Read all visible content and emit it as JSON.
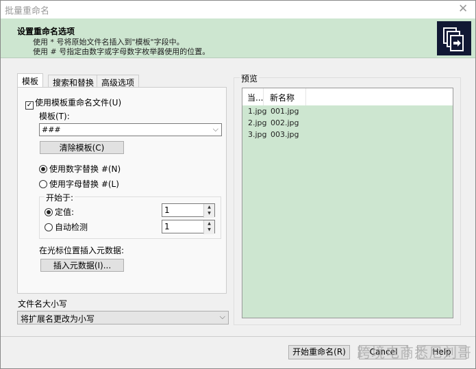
{
  "window": {
    "title": "批量重命名",
    "close": "✕"
  },
  "header": {
    "title": "设置重命名选项",
    "line1": "使用 * 号将原始文件名插入到\"模板\"字段中。",
    "line2": "使用 # 号指定由数字或字母数字枚举器使用的位置。"
  },
  "tabs": [
    "模板",
    "搜索和替换",
    "高级选项"
  ],
  "template_tab": {
    "use_template": "使用模板重命名文件(U)",
    "template_label": "模板(T):",
    "template_value": "###",
    "clear_button": "清除模板(C)",
    "radio_number": "使用数字替换 #(N)",
    "radio_letter": "使用字母替换 #(L)",
    "start_group": "开始于:",
    "fixed_label": "定值:",
    "fixed_value": "1",
    "auto_label": "自动检测",
    "auto_value": "1",
    "metadata_label": "在光标位置插入元数据:",
    "metadata_button": "插入元数据(I)..."
  },
  "case": {
    "label": "文件名大小写",
    "value": "将扩展名更改为小写"
  },
  "preview": {
    "label": "预览",
    "columns": [
      "当...",
      "新名称"
    ],
    "rows": [
      [
        "1.jpg",
        "001.jpg"
      ],
      [
        "2.jpg",
        "002.jpg"
      ],
      [
        "3.jpg",
        "003.jpg"
      ]
    ]
  },
  "footer": {
    "start": "开始重命名(R)",
    "cancel": "Cancel",
    "help": "Help"
  },
  "watermark": "跨境电商悉尼刘哥"
}
